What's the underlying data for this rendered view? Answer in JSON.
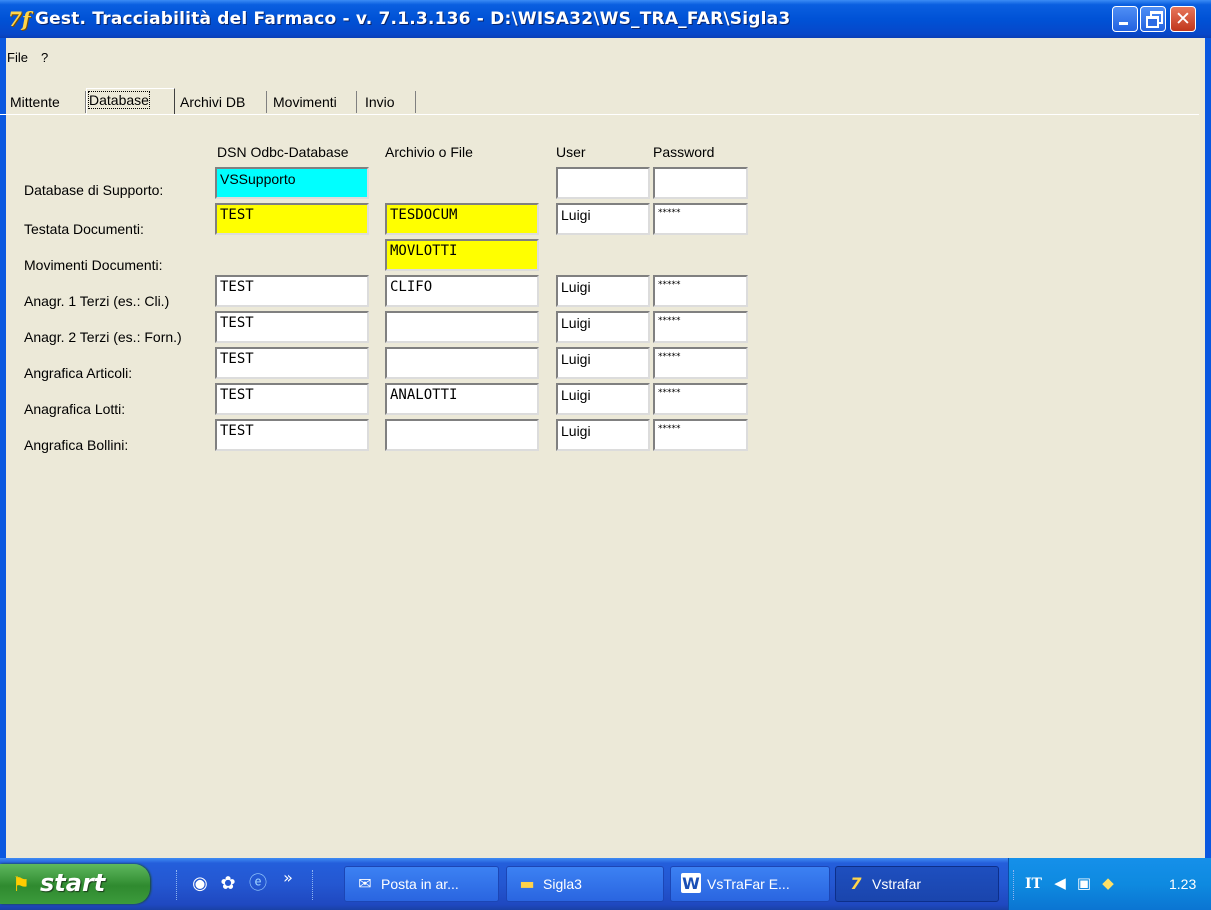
{
  "window": {
    "title": "Gest. Tracciabilità del Farmaco - v.  7.1.3.136 - D:\\WISA32\\WS_TRA_FAR\\Sigla3",
    "app_icon": "7f"
  },
  "menu": {
    "file": "File",
    "help": "?"
  },
  "tabs": [
    {
      "label": "Mittente"
    },
    {
      "label": "Database",
      "active": true
    },
    {
      "label": "Archivi DB"
    },
    {
      "label": "Movimenti"
    },
    {
      "label": "Invio"
    }
  ],
  "columns": {
    "dsn": "DSN Odbc-Database",
    "archivio": "Archivio o File",
    "user": "User",
    "password": "Password"
  },
  "rows": [
    {
      "label": "Database di Supporto:",
      "dsn": "VSSupporto",
      "dsn_color": "#00ffff",
      "archivio": null,
      "user": "",
      "password": ""
    },
    {
      "label": "Testata Documenti:",
      "dsn": "TEST",
      "dsn_color": "#ffff00",
      "archivio": "TESDOCUM",
      "archivio_color": "#ffff00",
      "user": "Luigi",
      "password": "*****"
    },
    {
      "label": "Movimenti Documenti:",
      "dsn": null,
      "archivio": "MOVLOTTI",
      "archivio_color": "#ffff00",
      "user": null,
      "password": null
    },
    {
      "label": "Anagr. 1 Terzi (es.: Cli.)",
      "dsn": "TEST",
      "archivio": "CLIFO",
      "user": "Luigi",
      "password": "*****"
    },
    {
      "label": "Anagr. 2 Terzi (es.: Forn.)",
      "dsn": "TEST",
      "archivio": "",
      "user": "Luigi",
      "password": "*****"
    },
    {
      "label": "Angrafica Articoli:",
      "dsn": "TEST",
      "archivio": "",
      "user": "Luigi",
      "password": "*****"
    },
    {
      "label": "Anagrafica Lotti:",
      "dsn": "TEST",
      "archivio": "ANALOTTI",
      "user": "Luigi",
      "password": "*****"
    },
    {
      "label": "Angrafica Bollini:",
      "dsn": "TEST",
      "archivio": "",
      "user": "Luigi",
      "password": "*****"
    }
  ],
  "taskbar": {
    "start": "start",
    "quicklaunch": [
      "browser-icon",
      "app-icon",
      "internet-explorer-icon"
    ],
    "overflow": "»",
    "buttons": [
      {
        "label": "Posta in ar...",
        "icon": "mail-icon"
      },
      {
        "label": "Sigla3",
        "icon": "folder-icon"
      },
      {
        "label": "VsTraFar E...",
        "icon": "word-icon"
      },
      {
        "label": "Vstrafar",
        "icon": "app-icon",
        "active": true
      }
    ],
    "tray": {
      "lang": "IT",
      "clock": "1.23"
    }
  },
  "colors": {
    "titlebar": "#0052d6",
    "window_bg": "#ece9d8",
    "highlight_cyan": "#00ffff",
    "highlight_yellow": "#ffff00",
    "taskbar": "#245edb",
    "start": "#3c9b3c"
  }
}
